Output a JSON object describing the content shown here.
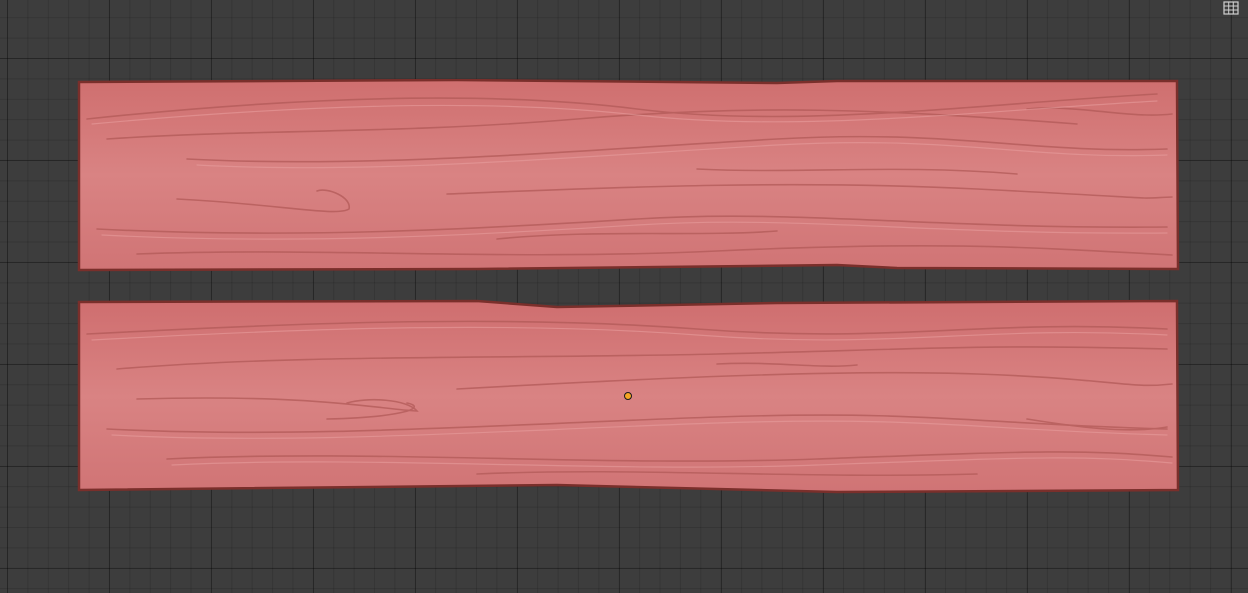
{
  "app": {
    "editor": "3D Viewport"
  },
  "viewport": {
    "background_color": "#3d3d3d",
    "grid_color": "#2e2e2e"
  },
  "objects": [
    {
      "name": "plank-top",
      "material_color": "#d7797a",
      "edge_color": "#8f3a36"
    },
    {
      "name": "plank-bottom",
      "material_color": "#d7797a",
      "edge_color": "#8f3a36"
    }
  ],
  "icons": {
    "grid_toggle": "grid-icon",
    "origin": "object-origin-dot"
  }
}
